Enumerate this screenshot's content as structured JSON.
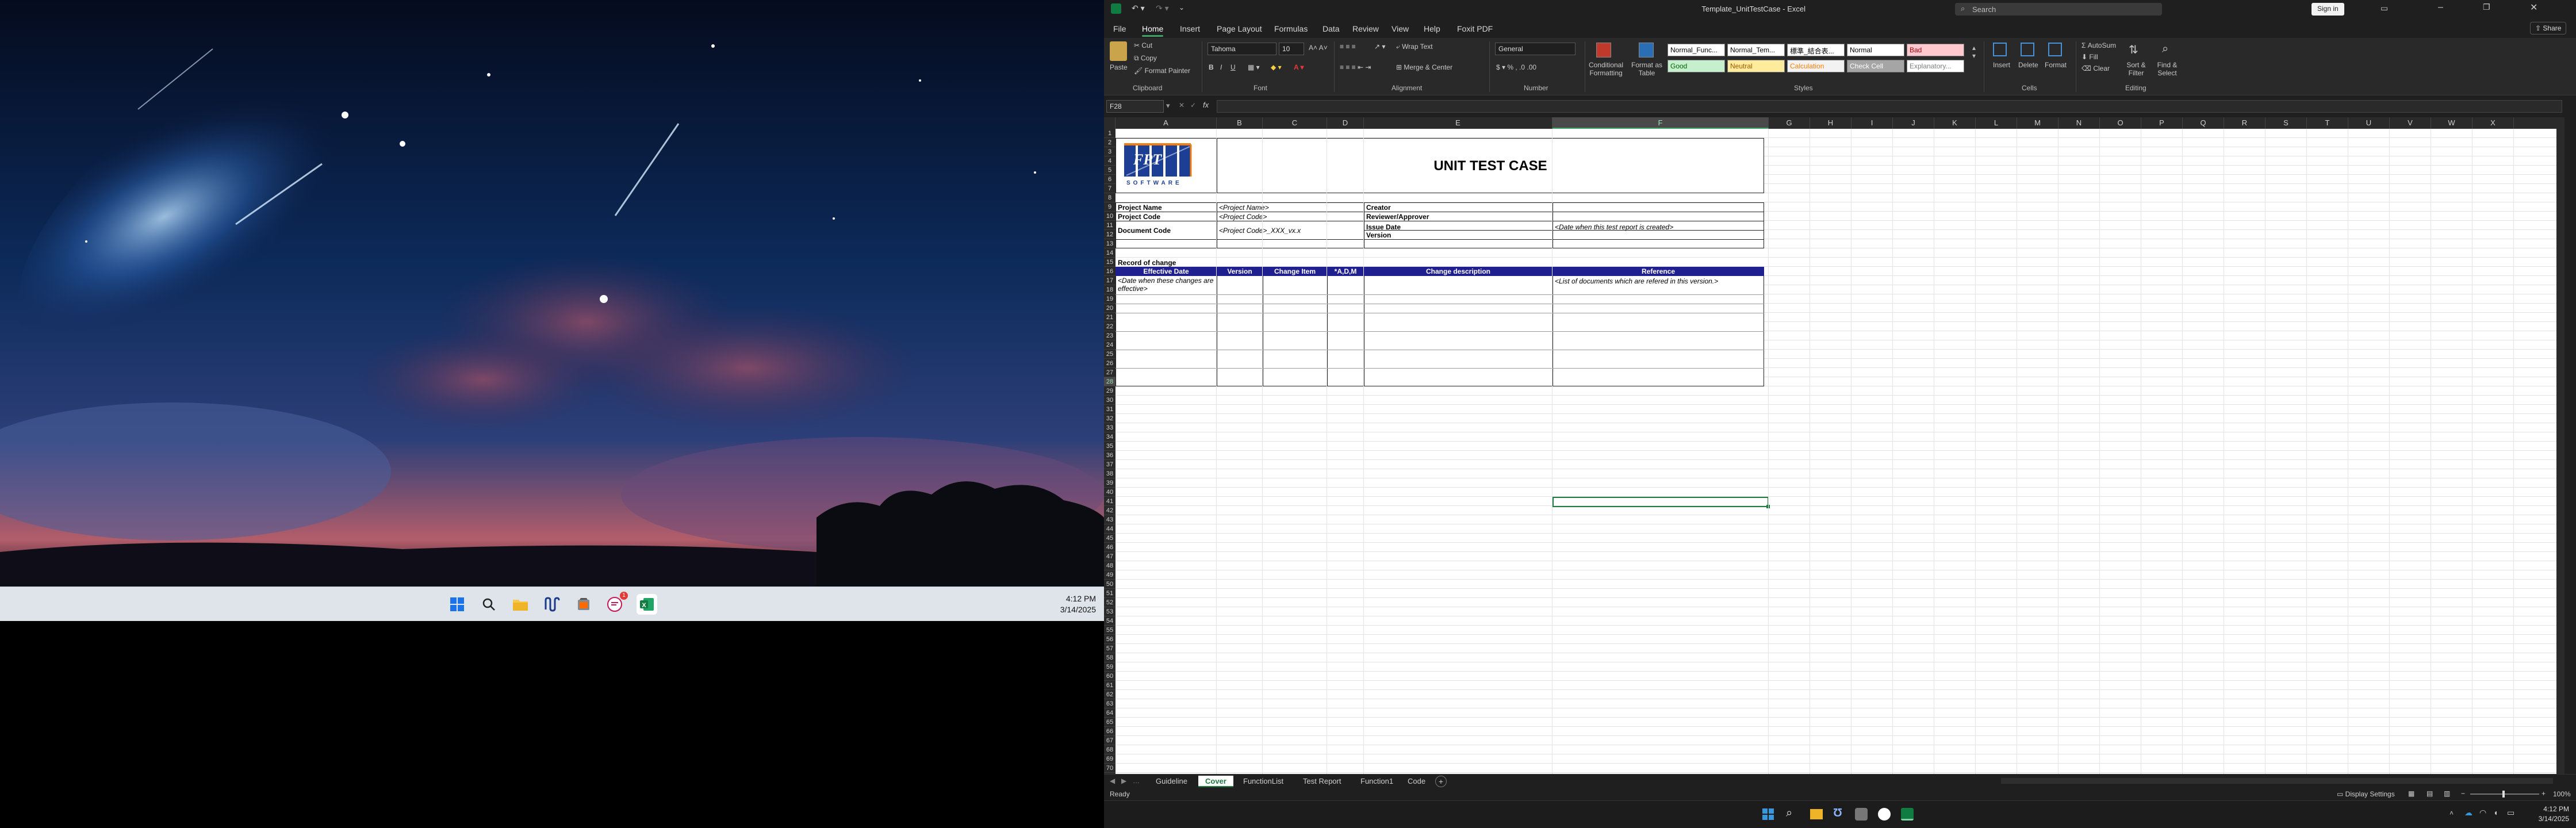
{
  "left_screen": {
    "taskbar_icons": [
      "windows-start-icon",
      "search-icon",
      "file-explorer-icon",
      "notion-icon",
      "browser-icon",
      "chat-app-icon",
      "excel-icon"
    ],
    "notification_badge": "1",
    "clock": {
      "time": "4:12 PM",
      "date": "3/14/2025"
    }
  },
  "excel": {
    "title": "Template_UnitTestCase - Excel",
    "search_placeholder": "Search",
    "sign_in": "Sign in",
    "menu": [
      "File",
      "Home",
      "Insert",
      "Page Layout",
      "Formulas",
      "Data",
      "Review",
      "View",
      "Help",
      "Foxit PDF"
    ],
    "active_menu": "Home",
    "share_label": "Share",
    "ribbon": {
      "clipboard": {
        "paste": "Paste",
        "cut": "Cut",
        "copy": "Copy",
        "format_painter": "Format Painter",
        "group": "Clipboard"
      },
      "font": {
        "name": "Tahoma",
        "size": "10",
        "group": "Font"
      },
      "alignment": {
        "wrap_text": "Wrap Text",
        "merge_center": "Merge & Center",
        "group": "Alignment"
      },
      "number": {
        "format": "General",
        "group": "Number"
      },
      "styles": {
        "conditional": "Conditional Formatting",
        "format_table": "Format as Table",
        "cells": [
          {
            "label": "Normal_Func...",
            "bg": "#ffffff",
            "fg": "#000000"
          },
          {
            "label": "Normal_Tem...",
            "bg": "#ffffff",
            "fg": "#000000"
          },
          {
            "label": "標準_結合表...",
            "bg": "#ffffff",
            "fg": "#000000"
          },
          {
            "label": "Normal",
            "bg": "#ffffff",
            "fg": "#000000"
          },
          {
            "label": "Bad",
            "bg": "#ffc7ce",
            "fg": "#9c0006"
          },
          {
            "label": "Good",
            "bg": "#c6efce",
            "fg": "#006100"
          },
          {
            "label": "Neutral",
            "bg": "#ffeb9c",
            "fg": "#9c5700"
          },
          {
            "label": "Calculation",
            "bg": "#f2f2f2",
            "fg": "#fa7d00"
          },
          {
            "label": "Check Cell",
            "bg": "#a5a5a5",
            "fg": "#ffffff"
          },
          {
            "label": "Explanatory...",
            "bg": "#ffffff",
            "fg": "#7f7f7f"
          }
        ],
        "group": "Styles"
      },
      "cells_group": {
        "insert": "Insert",
        "delete": "Delete",
        "format": "Format",
        "group": "Cells"
      },
      "editing": {
        "autosum": "AutoSum",
        "fill": "Fill",
        "clear": "Clear",
        "sort": "Sort & Filter",
        "find": "Find & Select",
        "group": "Editing"
      }
    },
    "name_box": "F28",
    "columns": [
      "A",
      "B",
      "C",
      "D",
      "E",
      "F",
      "G",
      "H",
      "I",
      "J",
      "K",
      "L",
      "M",
      "N",
      "O",
      "P",
      "Q",
      "R",
      "S",
      "T",
      "U",
      "V",
      "W",
      "X"
    ],
    "selected_column": "F",
    "selected_row": "28",
    "sheet": {
      "logo_text": "FPT",
      "logo_sub": "SOFTWARE",
      "title": "UNIT TEST CASE",
      "project_name_label": "Project Name",
      "project_name_value": "<Project Name>",
      "project_code_label": "Project Code",
      "project_code_value": "<Project Code>",
      "document_code_label": "Document Code",
      "document_code_value": "<Project Code>_XXX_vx.x",
      "creator_label": "Creator",
      "reviewer_label": "Reviewer/Approver",
      "issue_date_label": "Issue Date",
      "issue_date_value": "<Date when this test report is created>",
      "version_label": "Version",
      "record_label": "Record of change",
      "table_headers": [
        "Effective Date",
        "Version",
        "Change Item",
        "*A,D,M",
        "Change description",
        "Reference"
      ],
      "row1_effective": "<Date when these changes are effective>",
      "row1_reference": "<List of documents which are refered in this version.>"
    },
    "sheet_tabs": [
      "Guideline",
      "Cover",
      "FunctionList",
      "Test Report",
      "Function1",
      "Code"
    ],
    "active_tab": "Cover",
    "status": "Ready",
    "display_settings": "Display Settings",
    "zoom": "100%"
  },
  "right_taskbar": {
    "icons": [
      "windows-start-icon",
      "search-icon",
      "file-explorer-icon",
      "notion-icon",
      "browser-icon",
      "chat-app-icon",
      "excel-icon"
    ],
    "clock": {
      "time": "4:12 PM",
      "date": "3/14/2025"
    }
  }
}
